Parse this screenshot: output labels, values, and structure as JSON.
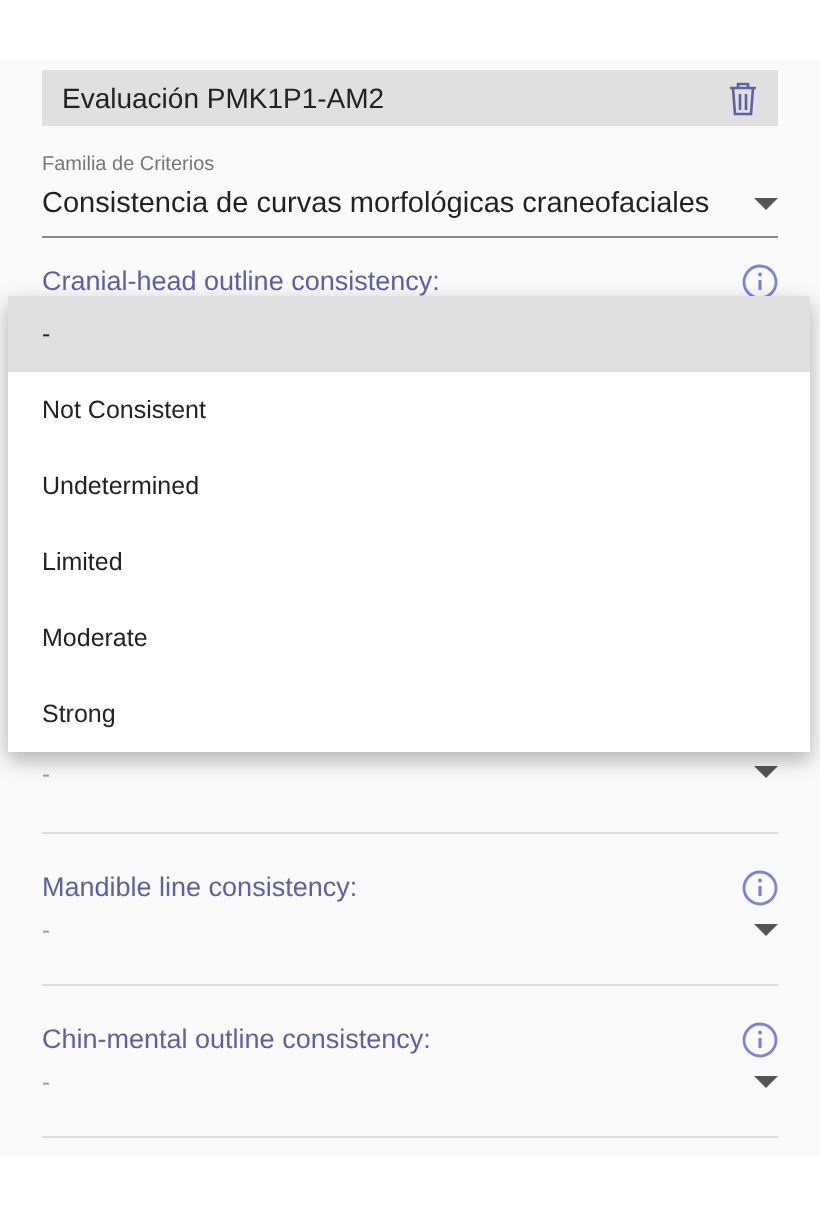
{
  "header": {
    "title": "Evaluación PMK1P1-AM2"
  },
  "family": {
    "label": "Familia de Criterios",
    "value": "Consistencia de curvas morfológicas craneofaciales"
  },
  "criteria": [
    {
      "label": "Cranial-head outline consistency:"
    },
    {
      "value": "-"
    },
    {
      "label": "Mandible line consistency:",
      "value": "-"
    },
    {
      "label": "Chin-mental outline consistency:",
      "value": "-"
    }
  ],
  "menu": [
    {
      "label": "-",
      "selected": true
    },
    {
      "label": "Not Consistent",
      "selected": false
    },
    {
      "label": "Undetermined",
      "selected": false
    },
    {
      "label": "Limited",
      "selected": false
    },
    {
      "label": "Moderate",
      "selected": false
    },
    {
      "label": "Strong",
      "selected": false
    }
  ]
}
